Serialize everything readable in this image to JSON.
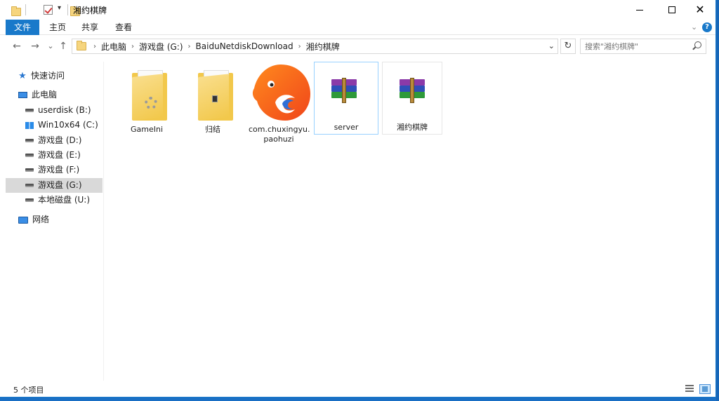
{
  "window": {
    "title": "湘约棋牌",
    "minimize_symbol": "—",
    "maximize_symbol": "☐",
    "close_symbol": "✕"
  },
  "quick_access_toolbar": {
    "dropdown_symbol": "▾"
  },
  "ribbon": {
    "tabs": [
      "文件",
      "主页",
      "共享",
      "查看"
    ],
    "expand_symbol": "⌄",
    "help_symbol": "?"
  },
  "nav": {
    "back_symbol": "←",
    "forward_symbol": "→",
    "history_symbol": "⌄",
    "up_symbol": "↑",
    "breadcrumb": [
      "此电脑",
      "游戏盘 (G:)",
      "BaiduNetdiskDownload",
      "湘约棋牌"
    ],
    "crumb_separator": "›",
    "address_dropdown_symbol": "⌄",
    "refresh_symbol": "↻",
    "search_placeholder": "搜索\"湘约棋牌\""
  },
  "sidebar": {
    "quick_access": "快速访问",
    "this_pc": "此电脑",
    "drives": [
      {
        "label": "userdisk (B:)",
        "icon": "drive-icon"
      },
      {
        "label": "Win10x64 (C:)",
        "icon": "windows-drive-icon"
      },
      {
        "label": "游戏盘 (D:)",
        "icon": "drive-icon"
      },
      {
        "label": "游戏盘 (E:)",
        "icon": "drive-icon"
      },
      {
        "label": "游戏盘 (F:)",
        "icon": "drive-icon"
      },
      {
        "label": "游戏盘 (G:)",
        "icon": "drive-icon",
        "selected": true
      },
      {
        "label": "本地磁盘 (U:)",
        "icon": "drive-icon"
      }
    ],
    "network": "网络"
  },
  "files": [
    {
      "name": "GameIni",
      "type": "folder-with-gear"
    },
    {
      "name": "归结",
      "type": "folder"
    },
    {
      "name": "com.chuxingyu.paohuzi",
      "line1": "com.chuxingyu.",
      "line2": "paohuzi",
      "type": "app"
    },
    {
      "name": "server",
      "type": "rar",
      "selected": true
    },
    {
      "name": "湘约棋牌",
      "type": "rar"
    }
  ],
  "status": {
    "item_count": "5 个项目"
  },
  "colors": {
    "accent": "#1979ca",
    "selection": "#cce8ff",
    "folder": "#f2c84b"
  }
}
